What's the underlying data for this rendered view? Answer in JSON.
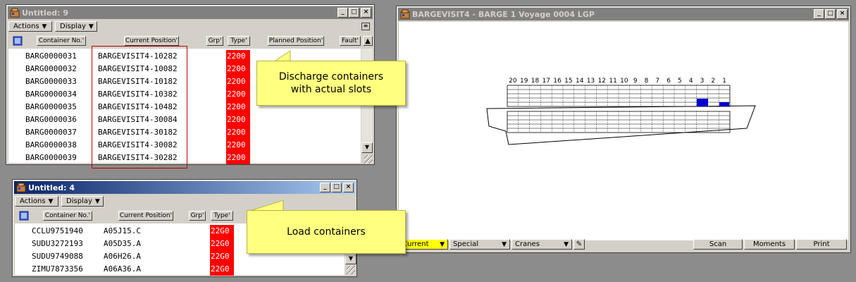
{
  "win1": {
    "title": "Untitled: 9",
    "menus": [
      "Actions",
      "Display"
    ],
    "columns": {
      "container": "Container No.'",
      "position": "Current Position'",
      "grp": "Grp'",
      "type": "Type'",
      "planned": "Planned Position'",
      "fault": "Fault'"
    },
    "rows": [
      {
        "container": "BARG0000031",
        "position": "BARGEVISIT4-10282",
        "type": "2200"
      },
      {
        "container": "BARG0000032",
        "position": "BARGEVISIT4-10082",
        "type": "2200"
      },
      {
        "container": "BARG0000033",
        "position": "BARGEVISIT4-10182",
        "type": "2200"
      },
      {
        "container": "BARG0000034",
        "position": "BARGEVISIT4-10382",
        "type": "2200"
      },
      {
        "container": "BARG0000035",
        "position": "BARGEVISIT4-10482",
        "type": "2200"
      },
      {
        "container": "BARG0000036",
        "position": "BARGEVISIT4-30084",
        "type": "2200"
      },
      {
        "container": "BARG0000037",
        "position": "BARGEVISIT4-30182",
        "type": "2200"
      },
      {
        "container": "BARG0000038",
        "position": "BARGEVISIT4-30082",
        "type": "2200"
      },
      {
        "container": "BARG0000039",
        "position": "BARGEVISIT4-30282",
        "type": "2200"
      }
    ]
  },
  "win2": {
    "title": "Untitled: 4",
    "menus": [
      "Actions",
      "Display"
    ],
    "columns": {
      "container": "Container No.'",
      "position": "Current Position'",
      "grp": "Grp'",
      "type": "Type'"
    },
    "rows": [
      {
        "container": "CCLU9751940",
        "position": "A05J15.C",
        "type": "22G0"
      },
      {
        "container": "SUDU3272193",
        "position": "A05D35.A",
        "type": "22G0"
      },
      {
        "container": "SUDU9749088",
        "position": "A06H26.A",
        "type": "22G0"
      },
      {
        "container": "ZIMU7873356",
        "position": "A06A36.A",
        "type": "22G0"
      }
    ]
  },
  "win3": {
    "title": "BARGEVISIT4 - BARGE 1  Voyage 0004 LGP",
    "bays": [
      "20",
      "19",
      "18",
      "17",
      "16",
      "15",
      "14",
      "13",
      "12",
      "11",
      "10",
      "9",
      "8",
      "7",
      "6",
      "5",
      "4",
      "3",
      "2",
      "1"
    ],
    "bottom": {
      "current": "Current",
      "special": "Special",
      "cranes": "Cranes",
      "scan": "Scan",
      "moments": "Moments",
      "print": "Print"
    }
  },
  "callouts": {
    "discharge": "Discharge containers with actual slots",
    "load": "Load containers"
  },
  "colors": {
    "type_highlight": "#ff0000",
    "callout": "#ffff80",
    "slot": "#0000cc",
    "current_button": "#ffff00"
  }
}
